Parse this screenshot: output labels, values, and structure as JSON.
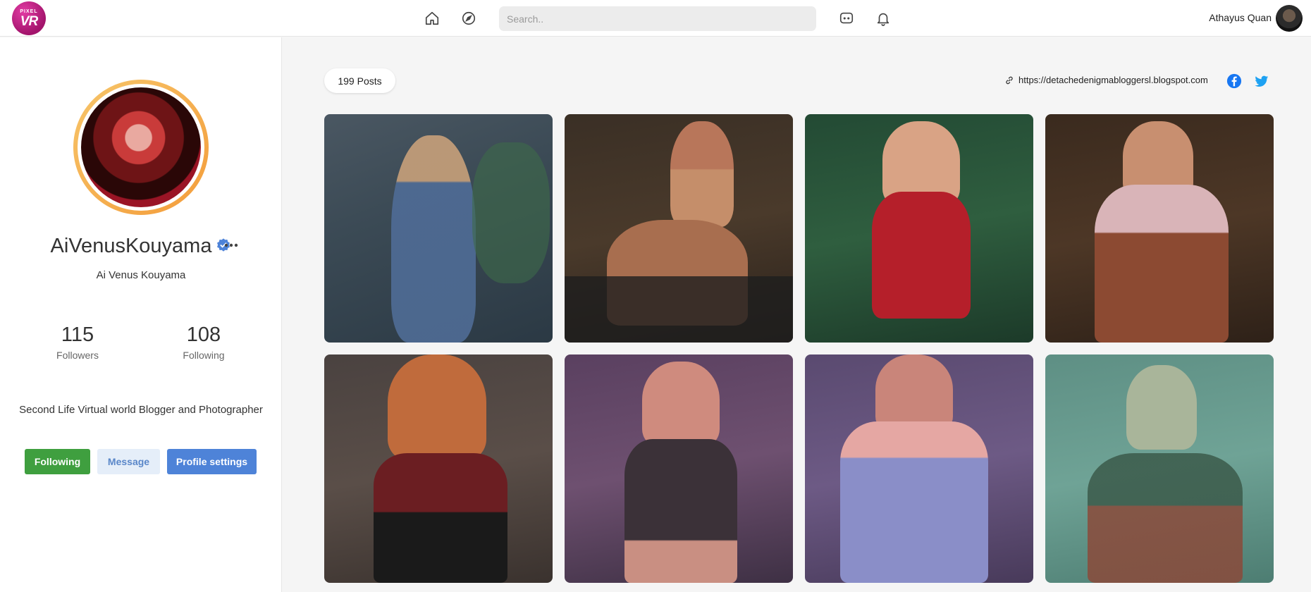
{
  "logo": {
    "line1": "PIXEL",
    "line2": "VR"
  },
  "nav": {
    "icons": [
      "home-icon",
      "explore-compass-icon",
      "chat-icon",
      "bell-icon"
    ],
    "search_placeholder": "Search..",
    "user_name": "Athayus Quan"
  },
  "profile": {
    "display_name": "AiVenusKouyama",
    "verified": true,
    "handle": "Ai Venus Kouyama",
    "followers_count": "115",
    "followers_label": "Followers",
    "following_count": "108",
    "following_label": "Following",
    "bio": "Second Life Virtual world Blogger and Photographer",
    "buttons": {
      "following": "Following",
      "message": "Message",
      "settings": "Profile settings"
    }
  },
  "main": {
    "posts_count": "199 Posts",
    "website": "https://detachedenigmabloggersl.blogspot.com",
    "socials": [
      "facebook-icon",
      "twitter-icon"
    ]
  },
  "colors": {
    "accent_green": "#3f9f3f",
    "accent_blue": "#4e83d8",
    "facebook": "#1877f2",
    "twitter": "#1da1f2",
    "avatar_ring": "#f39c3a"
  }
}
